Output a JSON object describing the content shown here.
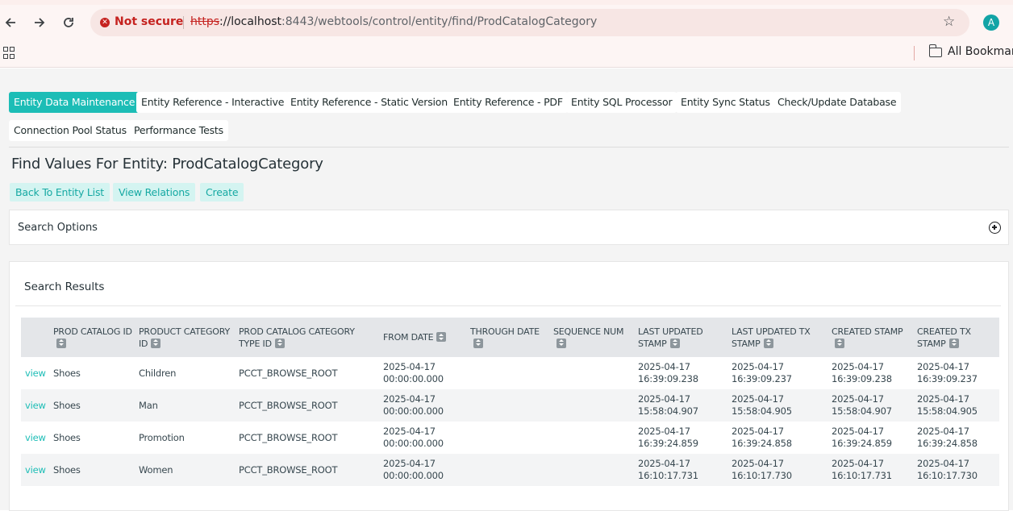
{
  "browser": {
    "not_secure_label": "Not secure",
    "url_protocol": "https",
    "url_host": "://localhost",
    "url_path": ":8443/webtools/control/entity/find/ProdCatalogCategory",
    "avatar_letter": "A",
    "bookmarks_label": "All Bookmar"
  },
  "tabs": [
    {
      "label": "Entity Data Maintenance",
      "active": true
    },
    {
      "label": "Entity Reference - Interactive",
      "active": false
    },
    {
      "label": "Entity Reference - Static Version",
      "active": false
    },
    {
      "label": "Entity Reference - PDF",
      "active": false
    },
    {
      "label": "Entity SQL Processor",
      "active": false
    },
    {
      "label": "Entity Sync Status",
      "active": false
    },
    {
      "label": "Check/Update Database",
      "active": false
    },
    {
      "label": "Connection Pool Status",
      "active": false
    },
    {
      "label": "Performance Tests",
      "active": false
    }
  ],
  "page": {
    "title": "Find Values For Entity: ProdCatalogCategory",
    "actions": {
      "back": "Back To Entity List",
      "relations": "View Relations",
      "create": "Create"
    },
    "search_options_label": "Search Options",
    "search_results_label": "Search Results"
  },
  "table": {
    "headers": [
      "PROD CATALOG ID",
      "PRODUCT CATEGORY ID",
      "PROD CATALOG CATEGORY TYPE ID",
      "FROM DATE",
      "THROUGH DATE",
      "SEQUENCE NUM",
      "LAST UPDATED STAMP",
      "LAST UPDATED TX STAMP",
      "CREATED STAMP",
      "CREATED TX STAMP"
    ],
    "view_label": "view",
    "rows": [
      {
        "prod_catalog_id": "Shoes",
        "product_category_id": "Children",
        "type_id": "PCCT_BROWSE_ROOT",
        "from_date_1": "2025-04-17",
        "from_date_2": "00:00:00.000",
        "through_date": "",
        "sequence_num": "",
        "last_updated_1": "2025-04-17",
        "last_updated_2": "16:39:09.238",
        "last_updated_tx_1": "2025-04-17",
        "last_updated_tx_2": "16:39:09.237",
        "created_1": "2025-04-17",
        "created_2": "16:39:09.238",
        "created_tx_1": "2025-04-17",
        "created_tx_2": "16:39:09.237"
      },
      {
        "prod_catalog_id": "Shoes",
        "product_category_id": "Man",
        "type_id": "PCCT_BROWSE_ROOT",
        "from_date_1": "2025-04-17",
        "from_date_2": "00:00:00.000",
        "through_date": "",
        "sequence_num": "",
        "last_updated_1": "2025-04-17",
        "last_updated_2": "15:58:04.907",
        "last_updated_tx_1": "2025-04-17",
        "last_updated_tx_2": "15:58:04.905",
        "created_1": "2025-04-17",
        "created_2": "15:58:04.907",
        "created_tx_1": "2025-04-17",
        "created_tx_2": "15:58:04.905"
      },
      {
        "prod_catalog_id": "Shoes",
        "product_category_id": "Promotion",
        "type_id": "PCCT_BROWSE_ROOT",
        "from_date_1": "2025-04-17",
        "from_date_2": "00:00:00.000",
        "through_date": "",
        "sequence_num": "",
        "last_updated_1": "2025-04-17",
        "last_updated_2": "16:39:24.859",
        "last_updated_tx_1": "2025-04-17",
        "last_updated_tx_2": "16:39:24.858",
        "created_1": "2025-04-17",
        "created_2": "16:39:24.859",
        "created_tx_1": "2025-04-17",
        "created_tx_2": "16:39:24.858"
      },
      {
        "prod_catalog_id": "Shoes",
        "product_category_id": "Women",
        "type_id": "PCCT_BROWSE_ROOT",
        "from_date_1": "2025-04-17",
        "from_date_2": "00:00:00.000",
        "through_date": "",
        "sequence_num": "",
        "last_updated_1": "2025-04-17",
        "last_updated_2": "16:10:17.731",
        "last_updated_tx_1": "2025-04-17",
        "last_updated_tx_2": "16:10:17.730",
        "created_1": "2025-04-17",
        "created_2": "16:10:17.731",
        "created_tx_1": "2025-04-17",
        "created_tx_2": "16:10:17.730"
      }
    ]
  }
}
